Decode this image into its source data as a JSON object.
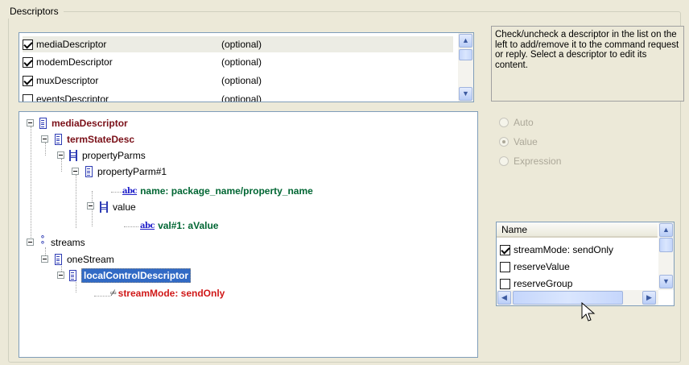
{
  "group": {
    "title": "Descriptors"
  },
  "descriptor_list": {
    "items": [
      {
        "name": "mediaDescriptor",
        "status": "(optional)",
        "checked": true,
        "selected": true
      },
      {
        "name": "modemDescriptor",
        "status": "(optional)",
        "checked": true,
        "selected": false
      },
      {
        "name": "muxDescriptor",
        "status": "(optional)",
        "checked": true,
        "selected": false
      },
      {
        "name": "eventsDescriptor",
        "status": "(optional)",
        "checked": false,
        "selected": false
      }
    ]
  },
  "help_text": "Check/uncheck a descriptor in the list on the left to add/remove it to the command request or reply. Select a descriptor to edit its content.",
  "tree": {
    "nodes": [
      {
        "label": "mediaDescriptor"
      },
      {
        "label": "termStateDesc"
      },
      {
        "label": "propertyParms"
      },
      {
        "label": "propertyParm#1"
      },
      {
        "label": "name: package_name/property_name"
      },
      {
        "label": "value"
      },
      {
        "label": "val#1: aValue"
      },
      {
        "label": "streams"
      },
      {
        "label": "oneStream"
      },
      {
        "label": "localControlDescriptor"
      },
      {
        "label": "streamMode: sendOnly"
      }
    ]
  },
  "value_mode": {
    "options": [
      {
        "label": "Auto",
        "selected": false
      },
      {
        "label": "Value",
        "selected": true
      },
      {
        "label": "Expression",
        "selected": false
      }
    ],
    "enabled": false
  },
  "name_list": {
    "header": "Name",
    "items": [
      {
        "label": "streamMode: sendOnly",
        "checked": true
      },
      {
        "label": "reserveValue",
        "checked": false
      },
      {
        "label": "reserveGroup",
        "checked": false
      }
    ]
  },
  "icons": {
    "check": "checkbox-icon",
    "sequence": "sequence-icon",
    "set": "set-icon",
    "choice": "choice-icon",
    "string": "abc-string-icon",
    "boolean": "boolean-icon",
    "cursor": "mouse-pointer-icon"
  },
  "colors": {
    "root_label": "#7a1018",
    "value_label": "#006633",
    "edited_label": "#d01818",
    "selection": "#316ac5"
  }
}
